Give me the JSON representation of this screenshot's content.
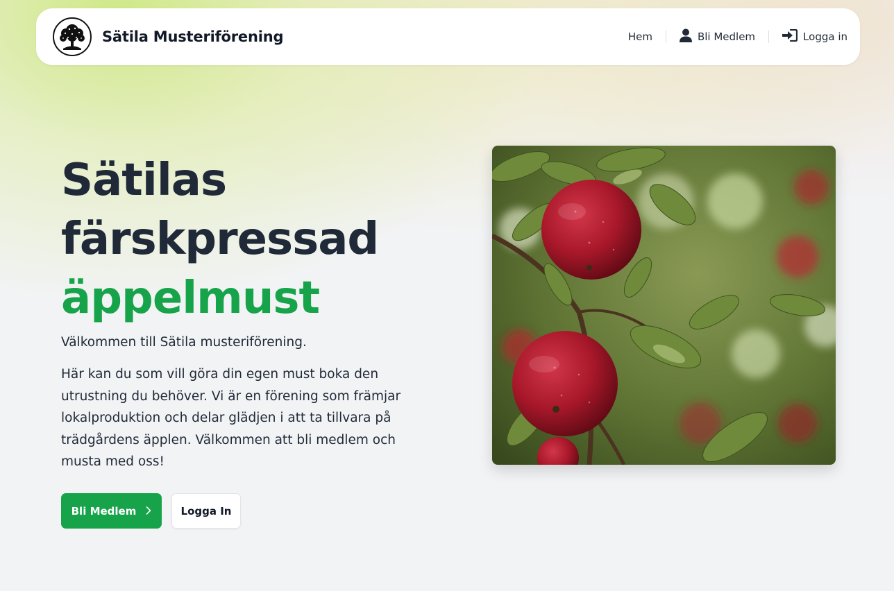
{
  "nav": {
    "brand": "Sätila Musteriförening",
    "logo_icon": "tree-icon",
    "links": [
      {
        "label": "Hem",
        "icon": ""
      },
      {
        "label": "Bli Medlem",
        "icon": "user-icon"
      },
      {
        "label": "Logga in",
        "icon": "login-icon"
      }
    ]
  },
  "hero": {
    "title_line1": "Sätilas",
    "title_line2": "färskpressad",
    "title_accent": "äppelmust",
    "intro": "Välkommen till Sätila musteriförening.",
    "body": "Här kan du som vill göra din egen must boka den utrustning du behöver. Vi är en förening som främjar lokalproduktion och delar glädjen i att ta tillvara på trädgårdens äpplen. Välkommen att bli medlem och musta med oss!",
    "primary_button": "Bli Medlem",
    "secondary_button": "Logga In",
    "image_subject": "red apples on branch"
  },
  "colors": {
    "accent": "#16a34a",
    "heading": "#1f2937",
    "background": "#f2f3f5"
  }
}
